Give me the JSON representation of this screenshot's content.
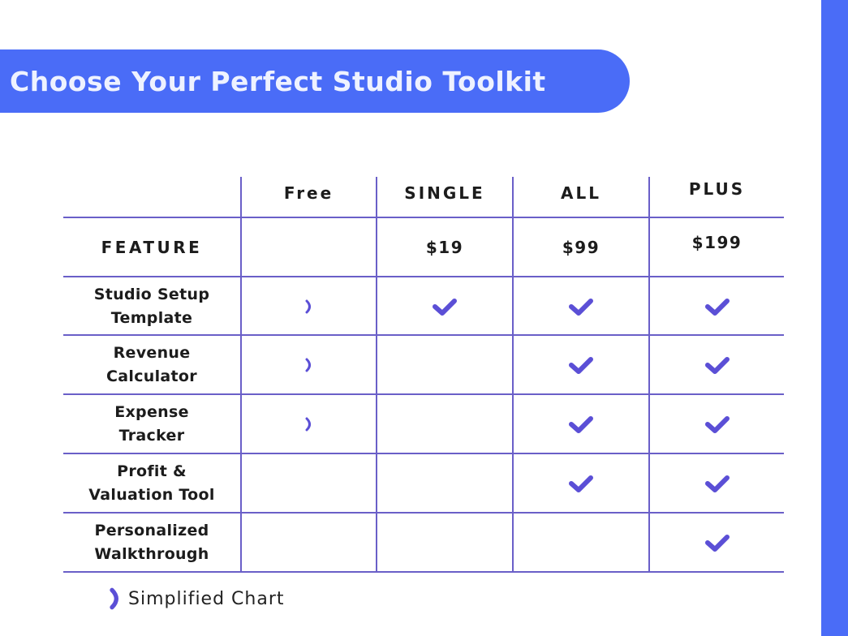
{
  "title": "Choose Your Perfect Studio Toolkit",
  "colors": {
    "accent": "#4a6cf7",
    "grid": "#6a5fc8",
    "icon": "#5b4fd6"
  },
  "table": {
    "plans": [
      {
        "name": "Free",
        "price": ""
      },
      {
        "name": "SINGLE",
        "price": "$19"
      },
      {
        "name": "ALL",
        "price": "$99"
      },
      {
        "name": "PLUS",
        "price": "$199"
      }
    ],
    "feature_header": "FEATURE",
    "rows": [
      {
        "feature": [
          "Studio Setup",
          "Template"
        ],
        "cells": [
          "partial",
          "check",
          "check",
          "check"
        ]
      },
      {
        "feature": [
          "Revenue",
          "Calculator"
        ],
        "cells": [
          "partial",
          "",
          "check",
          "check"
        ]
      },
      {
        "feature": [
          "Expense",
          "Tracker"
        ],
        "cells": [
          "partial",
          "",
          "check",
          "check"
        ]
      },
      {
        "feature": [
          "Profit &",
          "Valuation Tool"
        ],
        "cells": [
          "",
          "",
          "check",
          "check"
        ]
      },
      {
        "feature": [
          "Personalized",
          "Walkthrough"
        ],
        "cells": [
          "",
          "",
          "",
          "check"
        ]
      }
    ]
  },
  "legend": {
    "icon": "half-moon-icon",
    "label": "Simplified Chart"
  }
}
